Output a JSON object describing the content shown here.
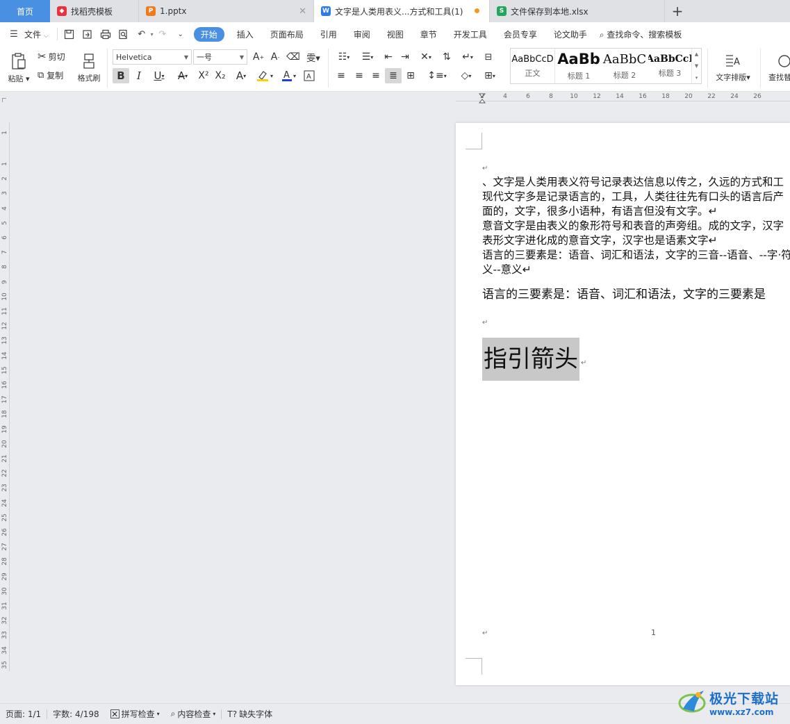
{
  "tabs": [
    {
      "label": "首页",
      "type": "home"
    },
    {
      "label": "找稻壳模板",
      "icon": "docer-icon",
      "icon_color": "#e8323c"
    },
    {
      "label": "1.pptx",
      "icon": "presentation-icon",
      "icon_color": "#f07b1d"
    },
    {
      "label": "文字是人类用表义...方式和工具(1)",
      "icon": "writer-icon",
      "icon_color": "#2b7de9"
    },
    {
      "label": "文件保存到本地.xlsx",
      "icon": "spreadsheet-icon",
      "icon_color": "#22a65a"
    }
  ],
  "tab_add_label": "+",
  "tab_close_label": "✕",
  "menubar": {
    "file": "文件",
    "items": [
      "开始",
      "插入",
      "页面布局",
      "引用",
      "审阅",
      "视图",
      "章节",
      "开发工具",
      "会员专享",
      "论文助手"
    ],
    "active_index": 0,
    "search": "查找命令、搜索模板"
  },
  "ribbon": {
    "paste": "粘贴",
    "cut": "剪切",
    "copy": "复制",
    "format_painter": "格式刷",
    "font_name": "Helvetica",
    "font_size": "一号",
    "styles": [
      {
        "sample": "AaBbCcD",
        "name": "正文"
      },
      {
        "sample": "AaBb",
        "name": "标题 1"
      },
      {
        "sample": "AaBbC",
        "name": "标题 2"
      },
      {
        "sample": "AaBbCcI",
        "name": "标题 3"
      }
    ],
    "text_layout": "文字排版",
    "find_replace": "查找替"
  },
  "ruler": {
    "h_labels": [
      "2",
      "4",
      "6",
      "8",
      "10",
      "12",
      "14",
      "16",
      "18",
      "20",
      "22",
      "24",
      "26"
    ],
    "v_labels": [
      "1",
      "1",
      "2",
      "3",
      "4",
      "5",
      "6",
      "7",
      "8",
      "9",
      "10",
      "11",
      "12",
      "13",
      "14",
      "15",
      "16",
      "17",
      "18",
      "19",
      "20",
      "21",
      "22",
      "23",
      "24",
      "25",
      "26",
      "27",
      "28",
      "29",
      "30",
      "31",
      "32",
      "33",
      "34",
      "35"
    ]
  },
  "document": {
    "para_mark": "↵",
    "lines": [
      "、文字是人类用表义符号记录表达信息以传之，久远的方式和工",
      "现代文字多是记录语言的，工具，人类往往先有口头的语言后产",
      "面的，文字，很多小语种，有语言但没有文字。↵",
      "意音文字是由表义的象形符号和表音的声旁组。成的文字，汉字",
      "表形文字进化成的意音文字，汉字也是语素文字↵",
      "语言的三要素是：语音、词汇和语法，文字的三音--语音、--字·符",
      "义--意义↵"
    ],
    "serif_line": "语言的三要素是：语音、词汇和语法，文字的三要素是",
    "heading": "指引箭头",
    "page_number": "1"
  },
  "statusbar": {
    "page": "页面: 1/1",
    "word_count": "字数: 4/198",
    "spell_check": "拼写检查",
    "content_check": "内容检查",
    "missing_font": "缺失字体"
  },
  "watermark": {
    "title": "极光下载站",
    "url": "www.xz7.com"
  },
  "colors": {
    "accent": "#4a90e2",
    "selection": "#c8c8c8",
    "modified_dot": "#f39a1e"
  }
}
